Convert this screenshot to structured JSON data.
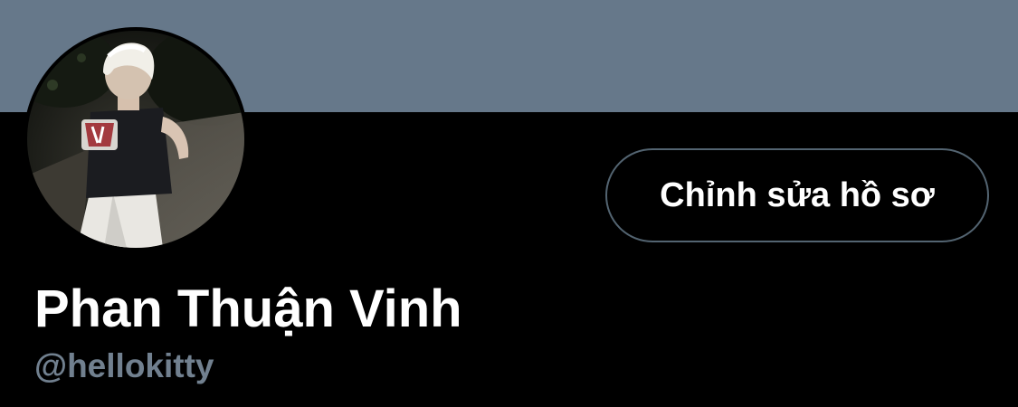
{
  "colors": {
    "banner": "#66788a",
    "background": "#000000",
    "name_text": "#ffffff",
    "username_text": "#71808f",
    "button_border": "#536471",
    "button_text": "#ffffff"
  },
  "profile": {
    "display_name": "Phan Thuận Vinh",
    "username": "@hellokitty",
    "avatar_icon": "avatar-photo",
    "edit_button_label": "Chỉnh sửa hồ sơ"
  }
}
